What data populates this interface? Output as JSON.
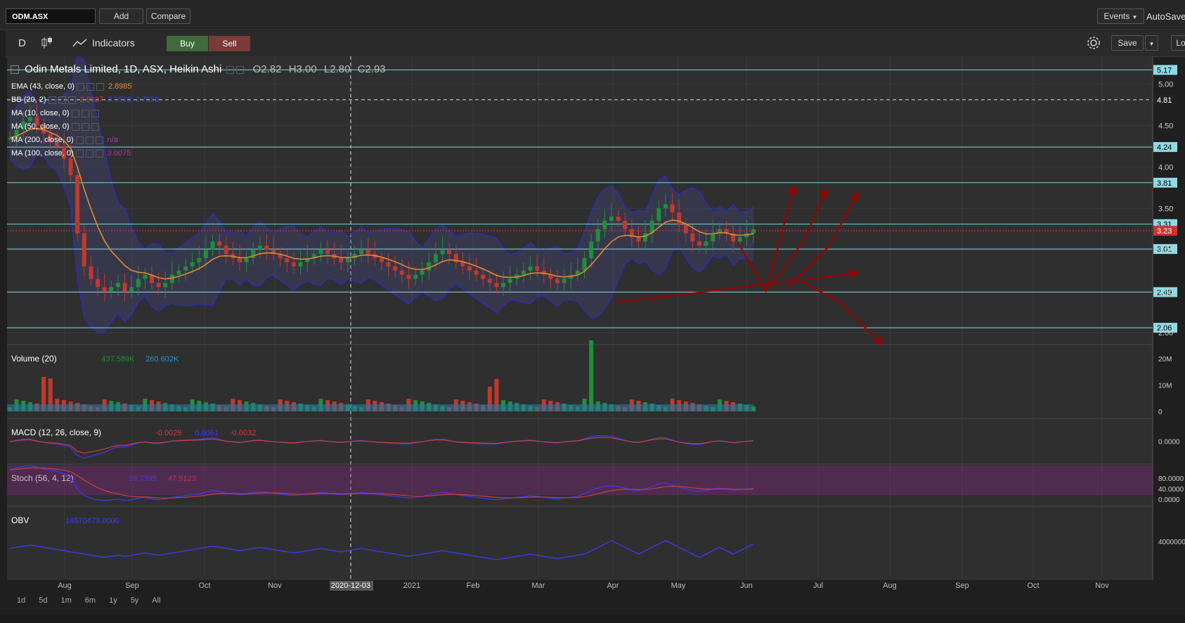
{
  "toolbar": {
    "symbol": "ODM.ASX",
    "add_label": "Add",
    "compare_label": "Compare",
    "events_label": "Events",
    "autosave_label": "AutoSave",
    "interval": "D",
    "indicators_label": "Indicators",
    "buy_label": "Buy",
    "sell_label": "Sell",
    "save_label": "Save",
    "lo_label": "Lo"
  },
  "header": {
    "title": "Odin Metals Limited, 1D, ASX, Heikin Ashi",
    "open": "O2.82",
    "high": "H3.00",
    "low": "L2.80",
    "close": "C2.93"
  },
  "colors": {
    "background": "#2f2f2f",
    "grid": "#3b3b3b",
    "up": "#1e8f3a",
    "down": "#c0392b",
    "ema": "#e08a2a",
    "bb_band": "#2a2ad0",
    "level_line": "#7fd6e0",
    "arrow": "#9b0000"
  },
  "indicators": [
    {
      "label": "EMA (43, close, 0)",
      "values": [
        "2.8985"
      ],
      "colors": [
        "#e08a2a"
      ]
    },
    {
      "label": "BB (20, 2)",
      "values": [
        "2.9037",
        "3.0515",
        "2.7559"
      ],
      "colors": [
        "#d23a3a",
        "#3a3aff",
        "#3a3aff"
      ]
    },
    {
      "label": "MA (10, close, 0)",
      "values": [],
      "colors": []
    },
    {
      "label": "MA (50, close, 0)",
      "values": [],
      "colors": []
    },
    {
      "label": "MA (200, close, 0)",
      "values": [
        "n/a"
      ],
      "colors": [
        "#b030b0"
      ]
    },
    {
      "label": "MA (100, close, 0)",
      "values": [
        "3.0075"
      ],
      "colors": [
        "#b030b0"
      ]
    }
  ],
  "chart_data": {
    "type": "candlestick",
    "title": "Odin Metals Limited, 1D, ASX, Heikin Ashi",
    "price_axis": {
      "ticks": [
        "5.00",
        "4.50",
        "4.00",
        "3.50",
        "3.00",
        "2.50",
        "2.00"
      ]
    },
    "horizontal_levels": [
      "5.17",
      "4.24",
      "3.81",
      "3.31",
      "3.01",
      "2.49",
      "2.06"
    ],
    "dashed_level": "4.81",
    "last_price": "3.23",
    "x_ticks": [
      "Aug",
      "Sep",
      "Oct",
      "Nov",
      "2020-12-03",
      "2021",
      "Feb",
      "Mar",
      "Apr",
      "May",
      "Jun",
      "Jul",
      "Aug",
      "Sep",
      "Oct",
      "Nov"
    ],
    "crosshair_date": "2020-12-03",
    "close_series": [
      4.35,
      4.45,
      4.55,
      4.6,
      4.5,
      4.4,
      4.3,
      4.25,
      4.1,
      3.9,
      3.2,
      2.8,
      2.65,
      2.55,
      2.5,
      2.55,
      2.6,
      2.5,
      2.55,
      2.65,
      2.7,
      2.6,
      2.55,
      2.6,
      2.7,
      2.75,
      2.8,
      2.85,
      2.9,
      3.0,
      3.1,
      3.05,
      2.95,
      2.9,
      2.85,
      2.9,
      3.0,
      3.05,
      3.0,
      2.95,
      2.9,
      2.85,
      2.8,
      2.85,
      2.9,
      2.95,
      3.0,
      2.95,
      2.9,
      2.85,
      2.9,
      2.95,
      3.0,
      2.95,
      2.9,
      2.85,
      2.8,
      2.75,
      2.7,
      2.65,
      2.7,
      2.75,
      2.85,
      2.95,
      3.0,
      2.95,
      2.85,
      2.8,
      2.75,
      2.7,
      2.65,
      2.6,
      2.55,
      2.6,
      2.65,
      2.7,
      2.75,
      2.8,
      2.75,
      2.7,
      2.65,
      2.6,
      2.65,
      2.7,
      2.75,
      2.9,
      3.1,
      3.25,
      3.35,
      3.4,
      3.35,
      3.25,
      3.15,
      3.1,
      3.2,
      3.35,
      3.5,
      3.55,
      3.45,
      3.3,
      3.2,
      3.1,
      3.05,
      3.1,
      3.2,
      3.25,
      3.2,
      3.1,
      3.15,
      3.2,
      3.25
    ],
    "volume": {
      "label": "Volume (20)",
      "values": [
        "437.589K",
        "260.602K"
      ],
      "ticks": [
        "20M",
        "10M",
        "0"
      ]
    },
    "macd": {
      "label": "MACD (12, 26, close, 9)",
      "values": [
        "-0.0029",
        "0.0061",
        "-0.0032"
      ],
      "ticks": [
        "0.0000"
      ]
    },
    "stoch": {
      "label": "Stoch (56, 4, 12)",
      "values": [
        "39.7395",
        "47.9123"
      ],
      "ticks": [
        "80.0000",
        "40.0000",
        "0.0000"
      ]
    },
    "obv": {
      "label": "OBV",
      "values": [
        "18570473.0000"
      ],
      "ticks": [
        "4000000"
      ]
    }
  },
  "ranges": [
    "1d",
    "5d",
    "1m",
    "6m",
    "1y",
    "5y",
    "All"
  ]
}
